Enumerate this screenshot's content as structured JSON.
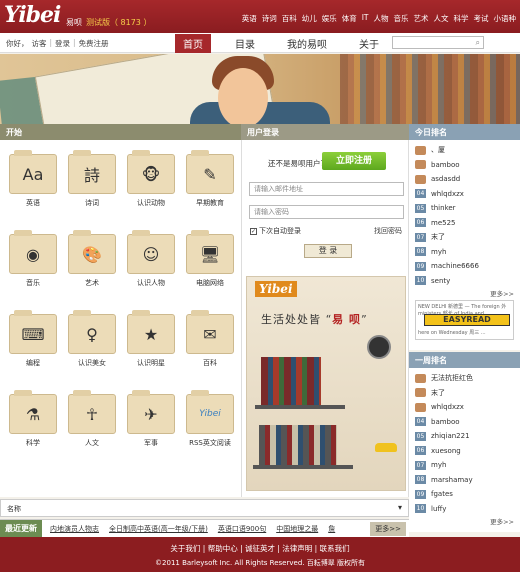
{
  "header": {
    "logo": "Yibei",
    "logo_cn": "易呗",
    "beta": "测试版（ 8173 ）",
    "categories": [
      "英语",
      "诗词",
      "百科",
      "幼儿",
      "娱乐",
      "体育",
      "IT",
      "人物",
      "音乐",
      "艺术",
      "人文",
      "科学",
      "考试",
      "小语种"
    ]
  },
  "userbar": {
    "greeting": "你好，",
    "visitor": "访客",
    "login": "登录",
    "register": "免费注册"
  },
  "nav": {
    "items": [
      "首页",
      "目录",
      "我的易呗",
      "关于"
    ]
  },
  "search": {
    "placeholder": ""
  },
  "sections": {
    "start": "开始",
    "login": "用户登录",
    "today_rank": "今日排名",
    "week_rank": "一周排名"
  },
  "grid": [
    {
      "label": "英语",
      "icon": "dictionary-icon",
      "glyph": "Aa"
    },
    {
      "label": "诗词",
      "icon": "book-icon",
      "glyph": "詩"
    },
    {
      "label": "认识动物",
      "icon": "monkey-icon",
      "glyph": "🐵"
    },
    {
      "label": "早期教育",
      "icon": "chalkboard-icon",
      "glyph": "✎"
    },
    {
      "label": "音乐",
      "icon": "record-icon",
      "glyph": "◉"
    },
    {
      "label": "艺术",
      "icon": "art-icon",
      "glyph": "🎨"
    },
    {
      "label": "认识人物",
      "icon": "person-icon",
      "glyph": "☺"
    },
    {
      "label": "电脑网络",
      "icon": "computer-icon",
      "glyph": "🖥"
    },
    {
      "label": "编程",
      "icon": "code-icon",
      "glyph": "⌨"
    },
    {
      "label": "认识美女",
      "icon": "woman-icon",
      "glyph": "♀"
    },
    {
      "label": "认识明星",
      "icon": "star-icon",
      "glyph": "★"
    },
    {
      "label": "百科",
      "icon": "encyclopedia-icon",
      "glyph": "✉"
    },
    {
      "label": "科学",
      "icon": "science-icon",
      "glyph": "⚗"
    },
    {
      "label": "人文",
      "icon": "statue-icon",
      "glyph": "☥"
    },
    {
      "label": "军事",
      "icon": "military-icon",
      "glyph": "✈"
    },
    {
      "label": "RSS英文阅读",
      "icon": "rss-icon",
      "glyph": "Yibei"
    }
  ],
  "login": {
    "not_registered": "还不是易呗用户?",
    "register_button": "立即注册",
    "email_placeholder": "请输入邮件地址",
    "password_placeholder": "请输入密码",
    "auto_login": "下次自动登录",
    "forgot": "找回密码",
    "submit": "登 录"
  },
  "promo": {
    "logo": "Yibei",
    "slogan_prefix": "生活处处皆 “",
    "slogan_highlight": "易 呗",
    "slogan_suffix": "”"
  },
  "today_rank": [
    {
      "n": "",
      "name": "、厦"
    },
    {
      "n": "",
      "name": "bamboo"
    },
    {
      "n": "",
      "name": "asdasdd"
    },
    {
      "n": "04",
      "name": "whlqdxzx"
    },
    {
      "n": "05",
      "name": "thinker"
    },
    {
      "n": "06",
      "name": "me525"
    },
    {
      "n": "07",
      "name": "末了"
    },
    {
      "n": "08",
      "name": "myh"
    },
    {
      "n": "09",
      "name": "machine6666"
    },
    {
      "n": "10",
      "name": "senty"
    }
  ],
  "more": "更多>>",
  "ad": {
    "top": "NEW DELHI 新德里 — The foreign 外 ministers 部长 of India and",
    "brand": "EASYREAD",
    "bottom": "here on Wednesday 周三 ..."
  },
  "week_rank": [
    {
      "n": "",
      "name": "无法抗拒红色"
    },
    {
      "n": "",
      "name": "末了"
    },
    {
      "n": "",
      "name": "whlqdxzx"
    },
    {
      "n": "04",
      "name": "bamboo"
    },
    {
      "n": "05",
      "name": "zhiqian221"
    },
    {
      "n": "06",
      "name": "xuesong"
    },
    {
      "n": "07",
      "name": "myh"
    },
    {
      "n": "08",
      "name": "marshamay"
    },
    {
      "n": "09",
      "name": "fgates"
    },
    {
      "n": "10",
      "name": "luffy"
    }
  ],
  "namebar": {
    "label": "名称"
  },
  "latest": {
    "tag": "最近更新",
    "items": [
      "内地演员人物志",
      "全日制高中英语(高一年级/下册)",
      "英语口语900句",
      "中国地理之最",
      "詹"
    ],
    "more": "更多>>"
  },
  "footer": {
    "links": "关于我们 | 帮助中心 | 诚征英才 | 法律声明 | 联系我们",
    "copyright": "©2011 Barleysoft Inc. All Rights Reserved. 百耘博翠 版权所有"
  },
  "colors": {
    "brand_red": "#a6282b",
    "register_green": "#6cb628",
    "rank_blue": "#8aa1b4",
    "latest_green": "#6c8c52"
  }
}
